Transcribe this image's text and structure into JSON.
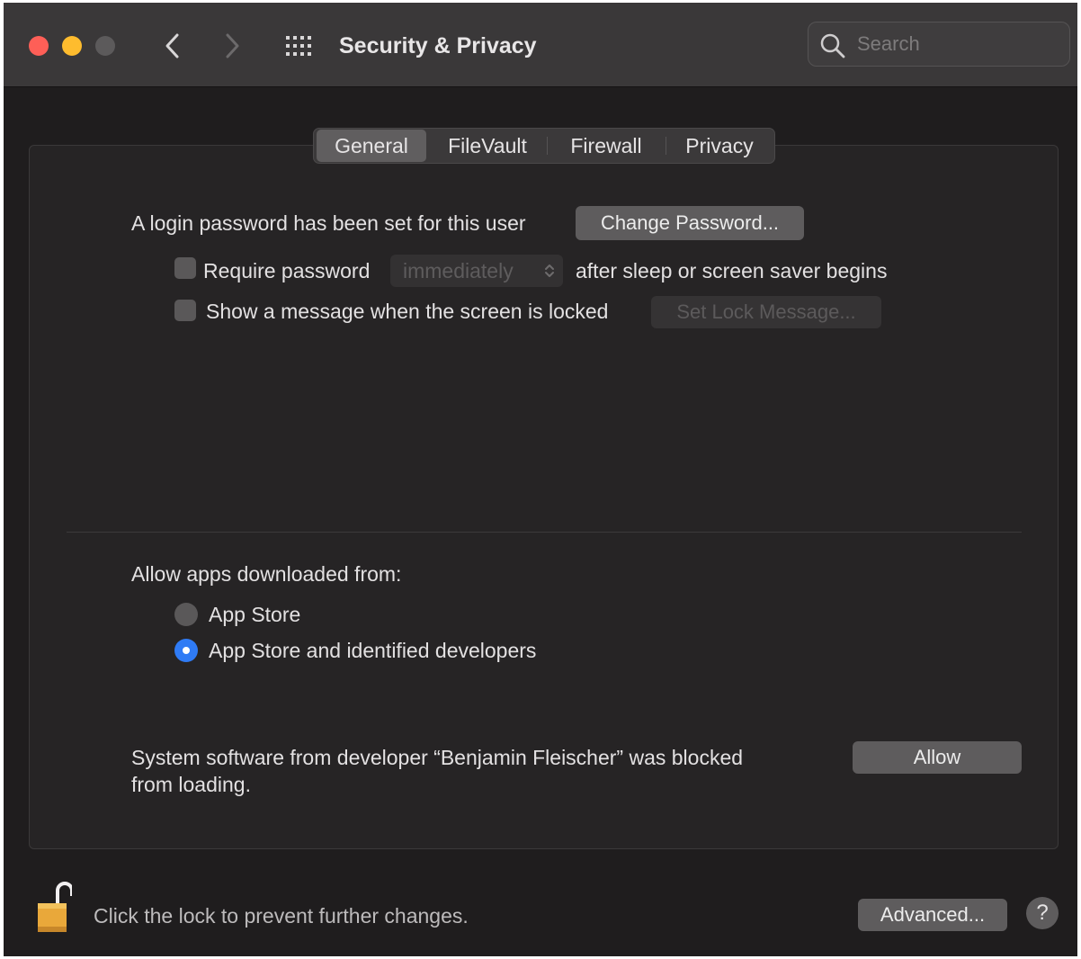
{
  "window": {
    "title": "Security & Privacy",
    "search_placeholder": "Search"
  },
  "tabs": [
    {
      "label": "General",
      "active": true
    },
    {
      "label": "FileVault",
      "active": false
    },
    {
      "label": "Firewall",
      "active": false
    },
    {
      "label": "Privacy",
      "active": false
    }
  ],
  "general": {
    "login_text": "A login password has been set for this user",
    "change_password_label": "Change Password...",
    "require_password_label": "Require password",
    "require_password_checked": false,
    "require_password_delay": "immediately",
    "after_sleep_text": "after sleep or screen saver begins",
    "show_message_label": "Show a message when the screen is locked",
    "show_message_checked": false,
    "set_lock_message_label": "Set Lock Message..."
  },
  "allow_apps": {
    "heading": "Allow apps downloaded from:",
    "options": [
      {
        "label": "App Store",
        "selected": false
      },
      {
        "label": "App Store and identified developers",
        "selected": true
      }
    ]
  },
  "blocked": {
    "line1": "System software from developer “Benjamin Fleischer” was blocked",
    "line2": "from loading.",
    "allow_label": "Allow"
  },
  "footer": {
    "lock_text": "Click the lock to prevent further changes.",
    "advanced_label": "Advanced...",
    "help_label": "?"
  },
  "icons": {
    "back": "chevron-left-icon",
    "forward": "chevron-right-icon",
    "show_all": "grid-icon",
    "search": "magnifier-icon",
    "lock": "unlocked-padlock-icon"
  },
  "colors": {
    "close": "#fe5f57",
    "minimize": "#febc2e",
    "radio_selected": "#2f7bf5",
    "lock_gold": "#e9a83a"
  }
}
